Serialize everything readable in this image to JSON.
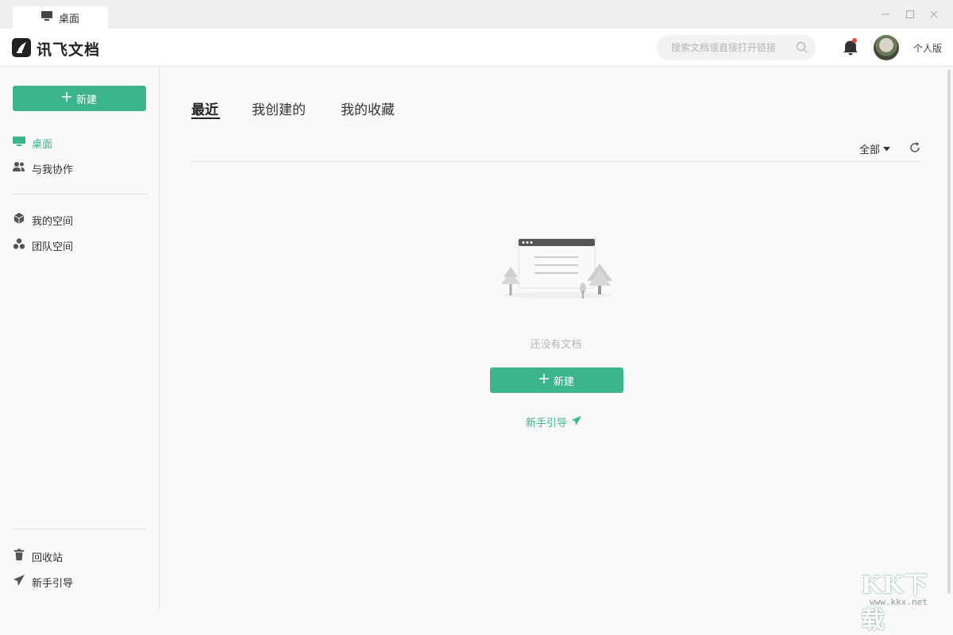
{
  "window": {
    "tab_label": "桌面",
    "minimize": "—",
    "maximize": "☐",
    "close": "✕"
  },
  "header": {
    "app_name": "讯飞文档",
    "search_placeholder": "搜索文档或直接打开链接",
    "plan_label": "个人版",
    "has_notification": true
  },
  "sidebar": {
    "new_button": "新建",
    "nav_top": [
      {
        "label": "桌面",
        "icon": "desktop-icon",
        "active": true
      },
      {
        "label": "与我协作",
        "icon": "users-icon",
        "active": false
      }
    ],
    "nav_spaces": [
      {
        "label": "我的空间",
        "icon": "cube-icon"
      },
      {
        "label": "团队空间",
        "icon": "team-icon"
      }
    ],
    "nav_bottom": [
      {
        "label": "回收站",
        "icon": "trash-icon"
      },
      {
        "label": "新手引导",
        "icon": "paper-plane-icon"
      }
    ]
  },
  "main": {
    "tabs": [
      {
        "label": "最近",
        "active": true
      },
      {
        "label": "我创建的",
        "active": false
      },
      {
        "label": "我的收藏",
        "active": false
      }
    ],
    "filter_label": "全部",
    "empty_text": "还没有文档",
    "new_button": "新建",
    "guide_link": "新手引导"
  },
  "watermark": {
    "text": "KK下载",
    "url": "www.kkx.net"
  },
  "colors": {
    "accent": "#3db58a",
    "sidebar_bg": "#f9f9f9",
    "title_bar_bg": "#efeff0"
  }
}
